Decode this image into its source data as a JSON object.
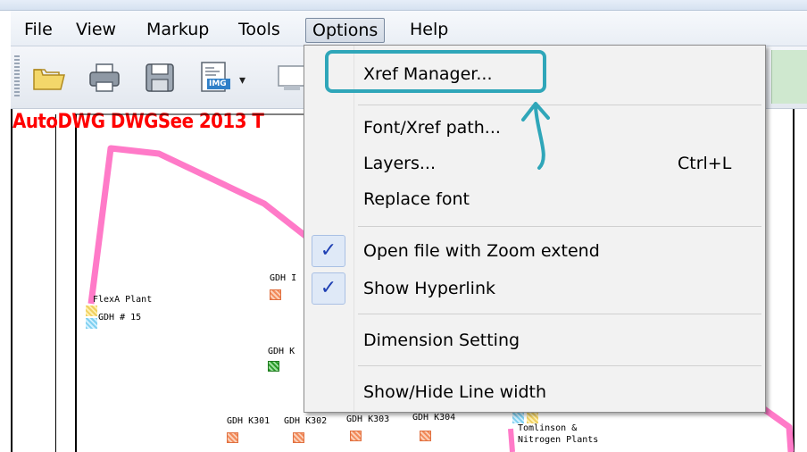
{
  "menubar": {
    "items": [
      "File",
      "View",
      "Markup",
      "Tools",
      "Options",
      "Help"
    ],
    "active": "Options"
  },
  "toolbar": {
    "buttons": [
      "open-folder-icon",
      "print-icon",
      "save-icon",
      "export-image-icon",
      "display-icon"
    ],
    "export_badge": "IMG",
    "dropdown_arrow": "▾"
  },
  "canvas": {
    "title": "AutoDWG DWGSee 2013 T",
    "labels": {
      "flexa_plant": "FlexA Plant",
      "gdh_15": "GDH # 15",
      "gdh_1": "GDH I",
      "gdh_k": "GDH K",
      "gdh_k301": "GDH K301",
      "gdh_k302": "GDH K302",
      "gdh_k303": "GDH K303",
      "gdh_k304": "GDH K304",
      "tomlinson_line1": "Tomlinson &",
      "tomlinson_line2": "Nitrogen Plants"
    }
  },
  "options_menu": {
    "items": [
      {
        "label": "Xref Manager...",
        "shortcut": "",
        "checked": false
      },
      {
        "label": "Font/Xref path...",
        "shortcut": "",
        "checked": false
      },
      {
        "label": "Layers...",
        "shortcut": "Ctrl+L",
        "checked": false
      },
      {
        "label": "Replace font",
        "shortcut": "",
        "checked": false
      },
      {
        "label": "Open file with Zoom extend",
        "shortcut": "",
        "checked": true
      },
      {
        "label": "Show Hyperlink",
        "shortcut": "",
        "checked": true
      },
      {
        "label": "Dimension Setting",
        "shortcut": "",
        "checked": false
      },
      {
        "label": "Show/Hide Line width",
        "shortcut": "",
        "checked": false
      }
    ],
    "check_glyph": "✓"
  },
  "colors": {
    "highlight": "#2fa6b9",
    "title_red": "#ff0000",
    "pipeline_pink": "#ff7ac8",
    "check_blue": "#1e3fb3"
  }
}
